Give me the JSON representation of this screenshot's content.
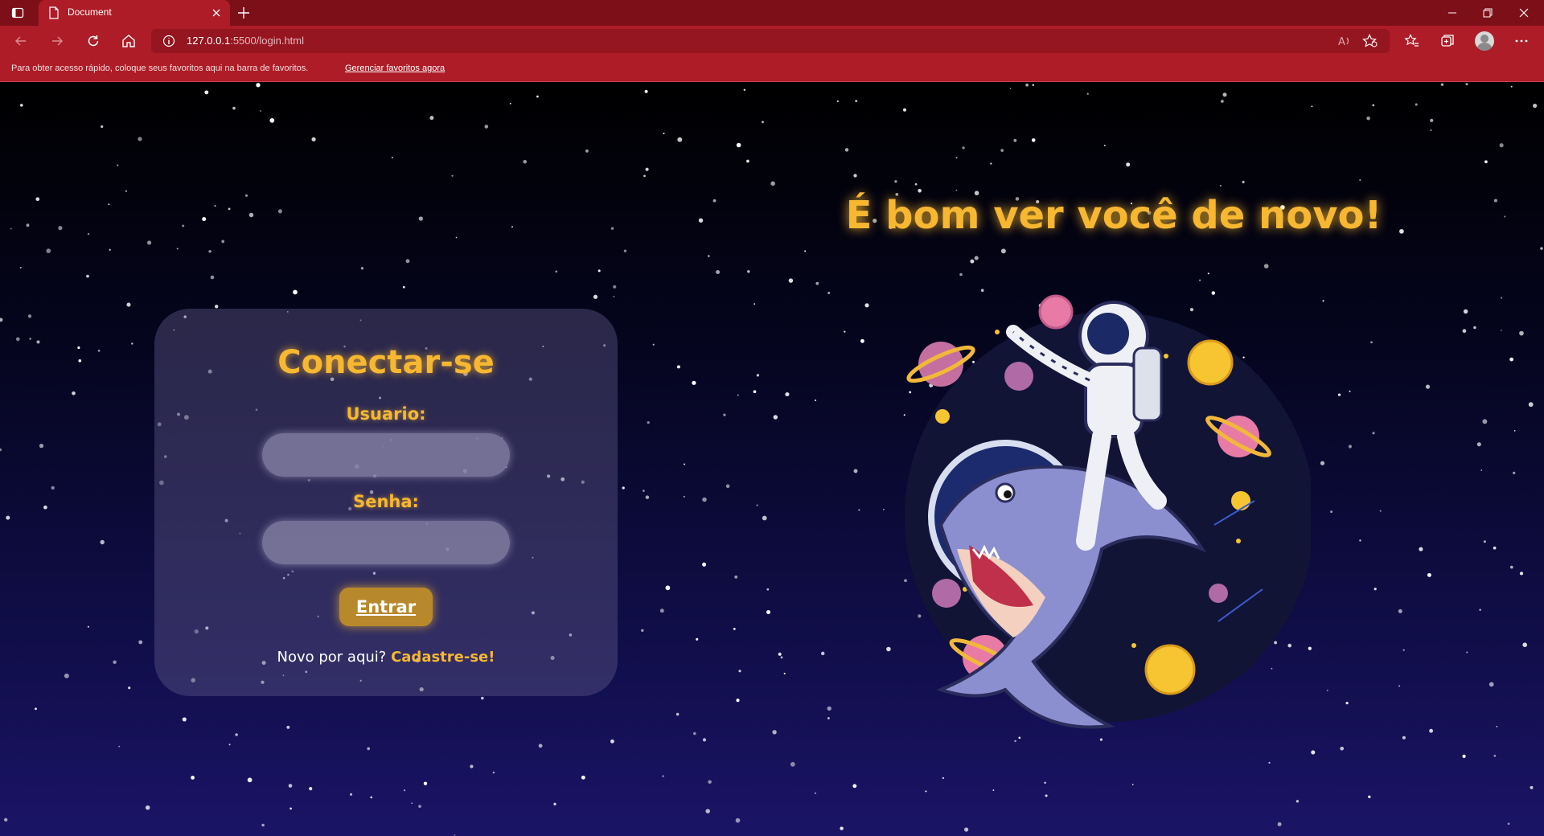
{
  "browser": {
    "tab_title": "Document",
    "url_host": "127.0.0.1",
    "url_path": ":5500/login.html",
    "favorites_bar_text": "Para obter acesso rápido, coloque seus favoritos aqui na barra de favoritos.",
    "favorites_bar_link": "Gerenciar favoritos agora",
    "read_aloud_label": "A⁾",
    "colors": {
      "titlebar": "#7d0f18",
      "toolbar": "#ad1c27",
      "addressbar": "#951520"
    }
  },
  "login": {
    "title": "Conectar-se",
    "username_label": "Usuario:",
    "password_label": "Senha:",
    "username_value": "",
    "password_value": "",
    "submit_label": "Entrar",
    "signup_prompt": "Novo por aqui?",
    "signup_link": "Cadastre-se!"
  },
  "hero": {
    "welcome_text": "É bom ver você de novo!",
    "illustration": "astronaut-riding-shark-icon"
  },
  "colors": {
    "accent": "#f7b731",
    "card": "#5a5482",
    "button": "#b8892c"
  }
}
